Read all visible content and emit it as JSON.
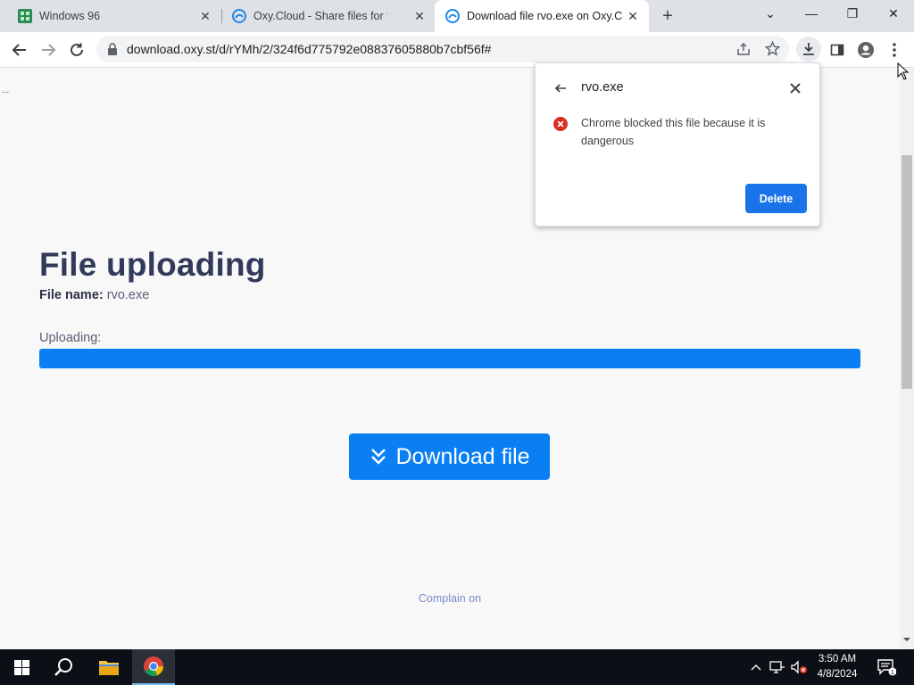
{
  "tabs": [
    {
      "title": "Windows 96",
      "icon": "windows96-favicon",
      "active": false
    },
    {
      "title": "Oxy.Cloud - Share files for free and",
      "icon": "oxy-cloud-favicon",
      "active": false
    },
    {
      "title": "Download file rvo.exe on Oxy.Cloud",
      "icon": "oxy-cloud-favicon",
      "active": true
    }
  ],
  "address_bar": {
    "url": "download.oxy.st/d/rYMh/2/324f6d775792e08837605880b7cbf56f#"
  },
  "page": {
    "heading": "File uploading",
    "file_name_label": "File name:",
    "file_name_value": " rvo.exe",
    "uploading_label": "Uploading:",
    "progress_percent": 100,
    "download_button_label": "Download file",
    "footer_link": "Complain on",
    "ellipsis": "..."
  },
  "download_popup": {
    "file_name": "rvo.exe",
    "message": "Chrome blocked this file because it is dangerous",
    "delete_button_label": "Delete"
  },
  "taskbar": {
    "time": "3:50 AM",
    "date": "4/8/2024"
  },
  "colors": {
    "accent": "#0a7ff4",
    "heading": "#313a5a",
    "popup_button": "#1a73e8",
    "error": "#d93025"
  }
}
